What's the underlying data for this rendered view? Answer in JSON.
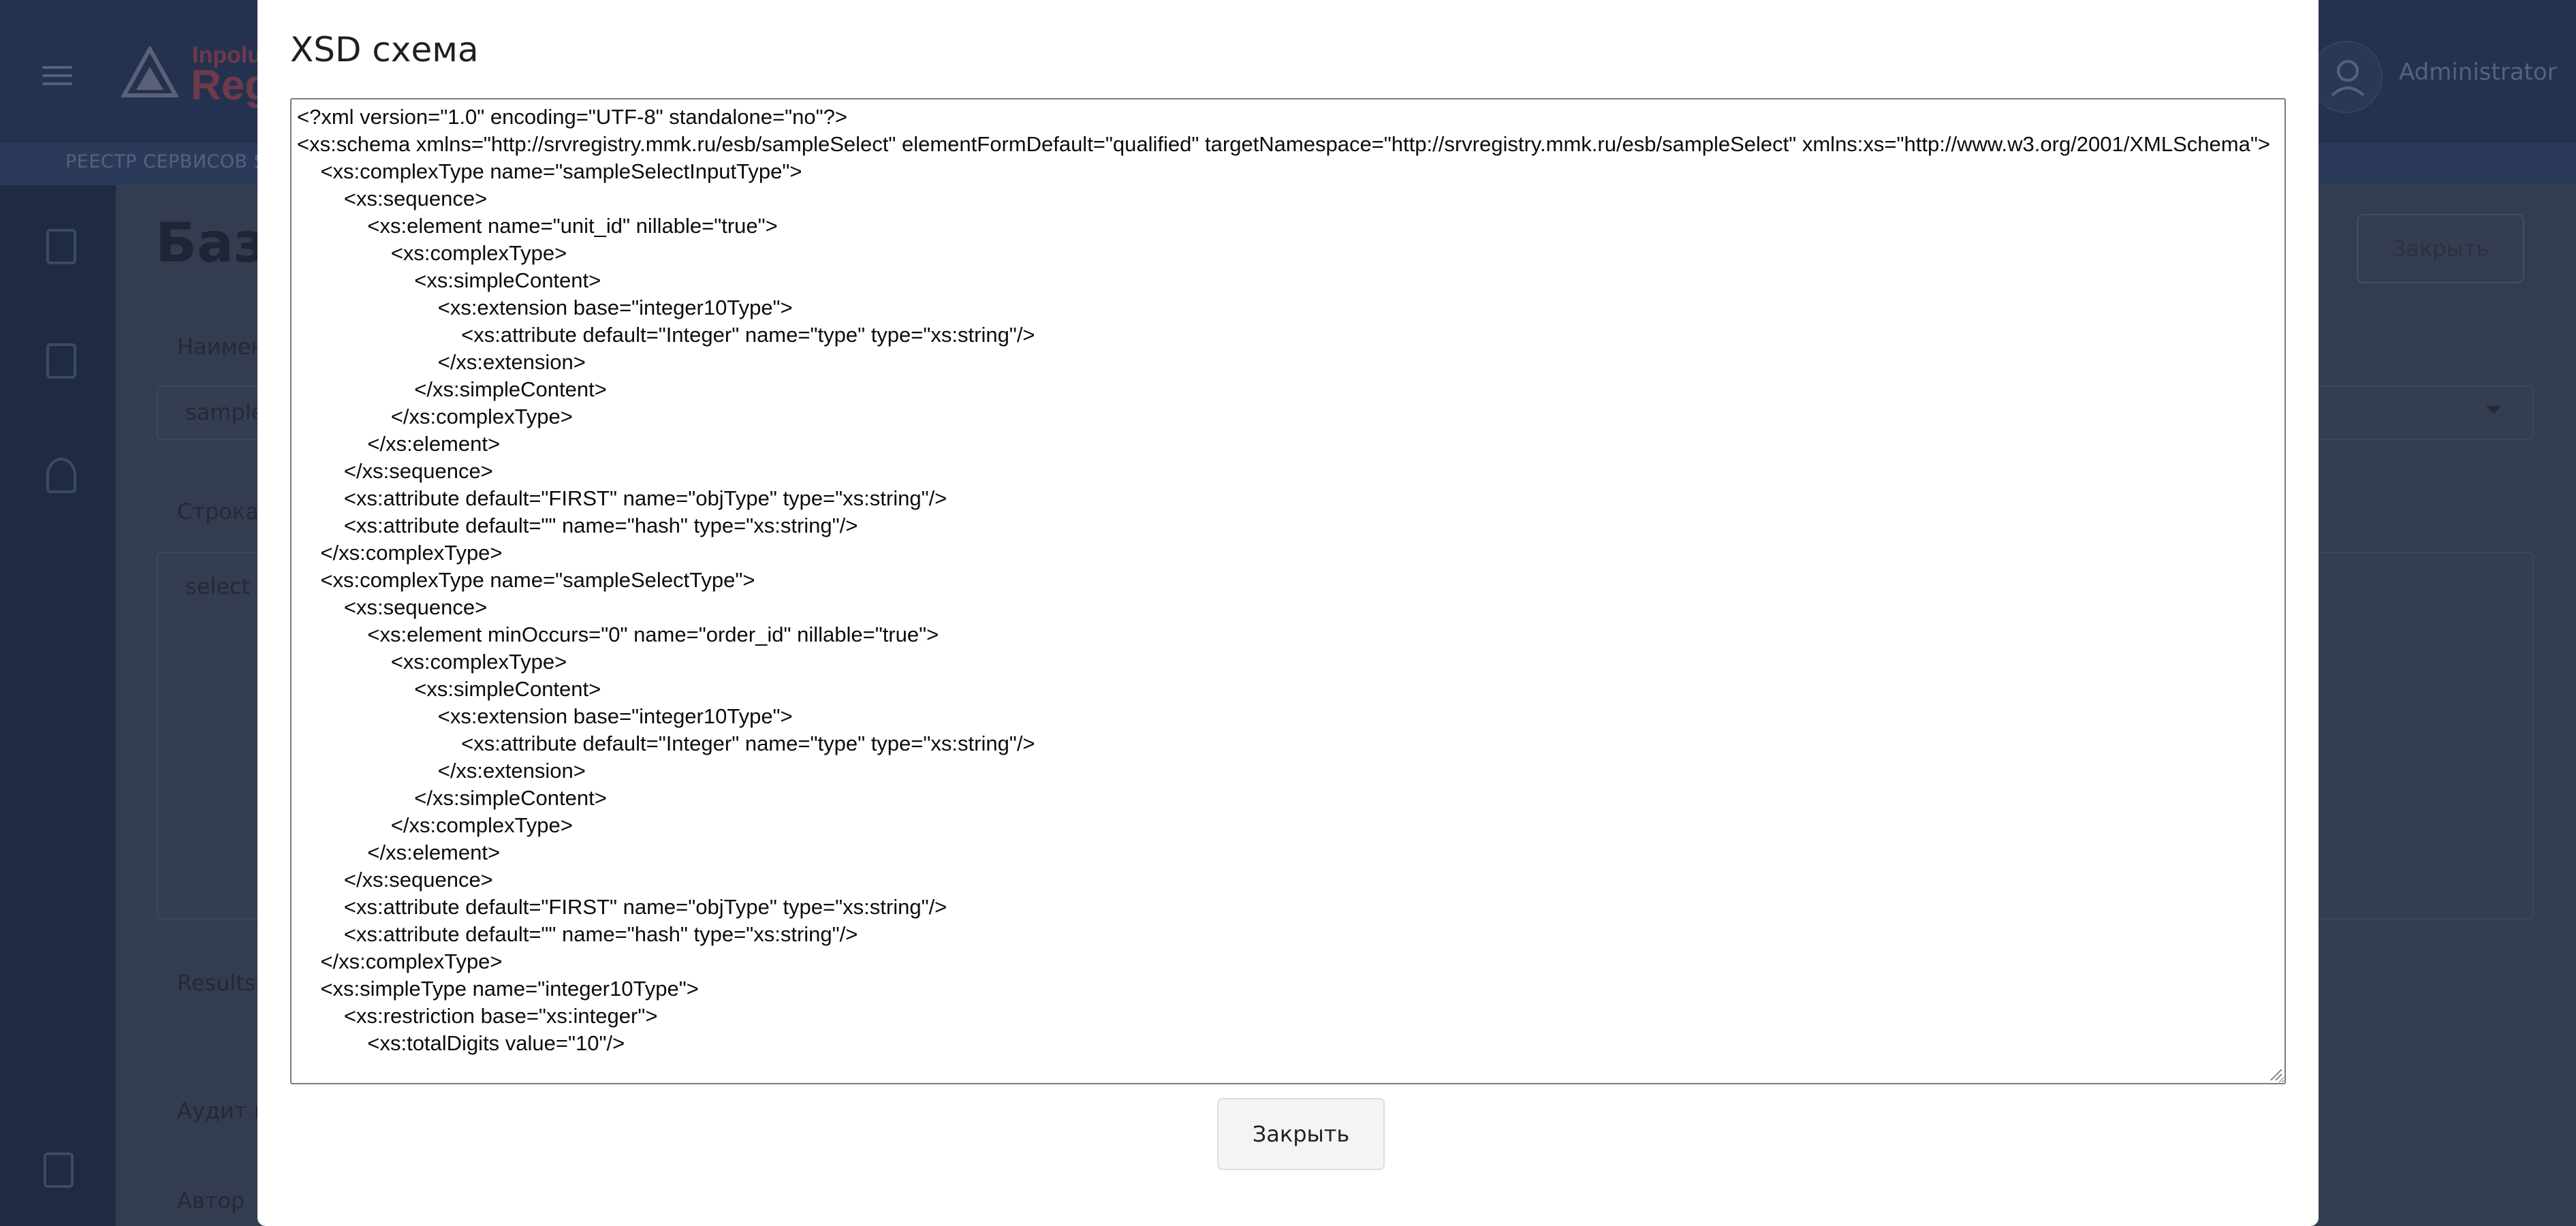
{
  "app": {
    "logo_line1": "Inpolu",
    "logo_line2": "Reg",
    "menu_strip": "РЕЕСТР СЕРВИСОВ SV",
    "user_name": "Administrator",
    "page_title": "Базо",
    "close_label": "Закрыть",
    "fields": {
      "name_label": "Наимен",
      "name_value": "sample",
      "query_label": "Строка",
      "query_value": "select a",
      "resultset_label": "Resultse",
      "audit_label": "Аудит в",
      "author_label": "Автор"
    }
  },
  "modal": {
    "title": "XSD схема",
    "xsd_text": "<?xml version=\"1.0\" encoding=\"UTF-8\" standalone=\"no\"?>\n<xs:schema xmlns=\"http://srvregistry.mmk.ru/esb/sampleSelect\" elementFormDefault=\"qualified\" targetNamespace=\"http://srvregistry.mmk.ru/esb/sampleSelect\" xmlns:xs=\"http://www.w3.org/2001/XMLSchema\">\n    <xs:complexType name=\"sampleSelectInputType\">\n        <xs:sequence>\n            <xs:element name=\"unit_id\" nillable=\"true\">\n                <xs:complexType>\n                    <xs:simpleContent>\n                        <xs:extension base=\"integer10Type\">\n                            <xs:attribute default=\"Integer\" name=\"type\" type=\"xs:string\"/>\n                        </xs:extension>\n                    </xs:simpleContent>\n                </xs:complexType>\n            </xs:element>\n        </xs:sequence>\n        <xs:attribute default=\"FIRST\" name=\"objType\" type=\"xs:string\"/>\n        <xs:attribute default=\"\" name=\"hash\" type=\"xs:string\"/>\n    </xs:complexType>\n    <xs:complexType name=\"sampleSelectType\">\n        <xs:sequence>\n            <xs:element minOccurs=\"0\" name=\"order_id\" nillable=\"true\">\n                <xs:complexType>\n                    <xs:simpleContent>\n                        <xs:extension base=\"integer10Type\">\n                            <xs:attribute default=\"Integer\" name=\"type\" type=\"xs:string\"/>\n                        </xs:extension>\n                    </xs:simpleContent>\n                </xs:complexType>\n            </xs:element>\n        </xs:sequence>\n        <xs:attribute default=\"FIRST\" name=\"objType\" type=\"xs:string\"/>\n        <xs:attribute default=\"\" name=\"hash\" type=\"xs:string\"/>\n    </xs:complexType>\n    <xs:simpleType name=\"integer10Type\">\n        <xs:restriction base=\"xs:integer\">\n            <xs:totalDigits value=\"10\"/>",
    "close_label": "Закрыть"
  }
}
